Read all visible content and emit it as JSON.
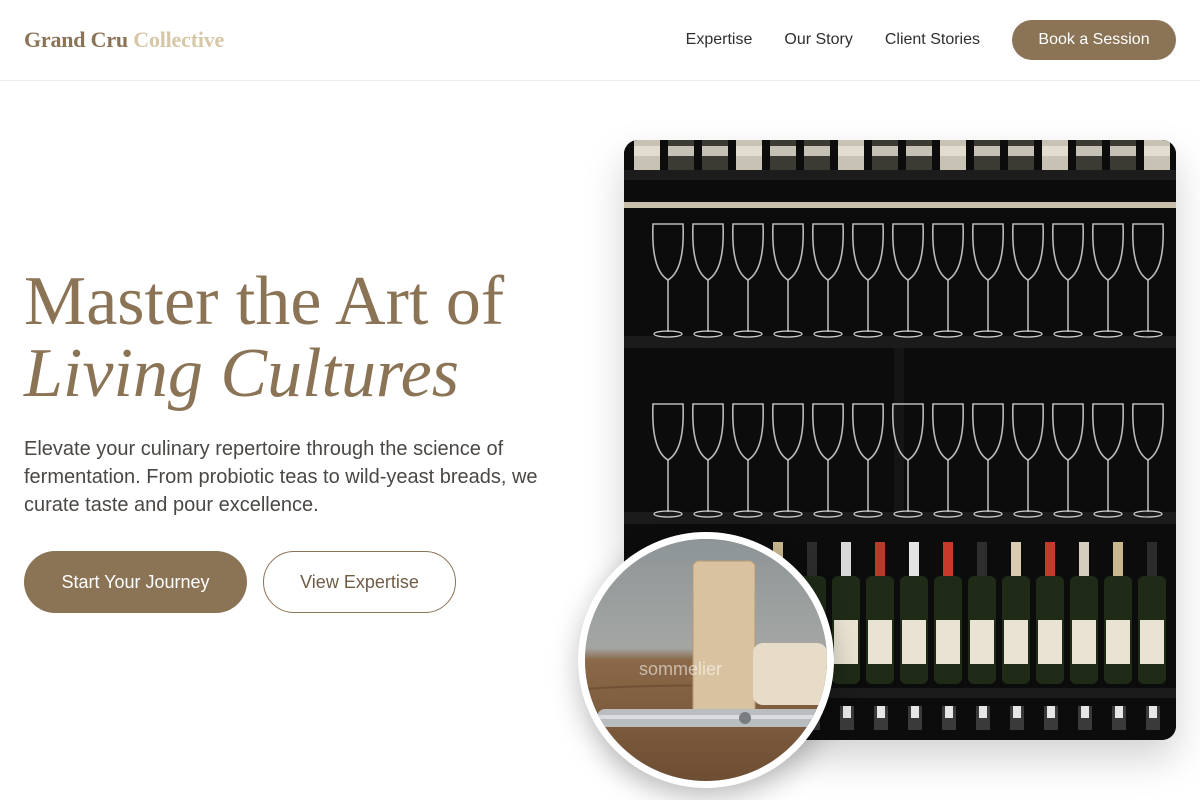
{
  "brand": {
    "part1": "Grand Cru",
    "part2": "Collective"
  },
  "nav": {
    "items": [
      "Expertise",
      "Our Story",
      "Client Stories"
    ],
    "cta": "Book a Session"
  },
  "hero": {
    "title_line1": "Master the Art of",
    "title_line2": "Living Cultures",
    "subtitle": "Elevate your culinary repertoire through the science of fermentation. From probiotic teas to wild-yeast breads, we curate taste and pour excellence.",
    "primary_button": "Start Your Journey",
    "secondary_button": "View Expertise"
  },
  "inset_caption": "sommelier",
  "colors": {
    "accent": "#8b7355",
    "accent_light": "#d6c7a7"
  }
}
